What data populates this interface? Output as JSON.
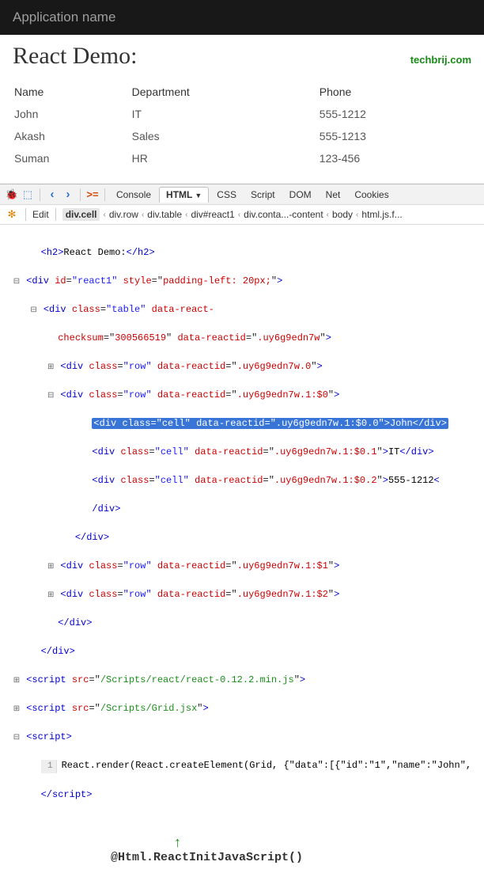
{
  "header": {
    "app_name": "Application name"
  },
  "page": {
    "title": "React Demo:",
    "brand": "techbrij.com"
  },
  "table": {
    "columns": [
      "Name",
      "Department",
      "Phone"
    ],
    "rows": [
      [
        "John",
        "IT",
        "555-1212"
      ],
      [
        "Akash",
        "Sales",
        "555-1213"
      ],
      [
        "Suman",
        "HR",
        "123-456"
      ]
    ]
  },
  "devtools": {
    "tabs": [
      "Console",
      "HTML",
      "CSS",
      "Script",
      "DOM",
      "Net",
      "Cookies"
    ],
    "active_tab": "HTML",
    "second_row": {
      "edit": "Edit"
    },
    "breadcrumbs": [
      "div.cell",
      "div.row",
      "div.table",
      "div#react1",
      "div.conta...-content",
      "body",
      "html.js.f..."
    ],
    "code": {
      "h2_text": "React Demo:",
      "react1_style": "padding-left: 20px;",
      "checksum": "300566519",
      "reactid_root": ".uy6g9edn7w",
      "reactid_row0": ".uy6g9edn7w.0",
      "reactid_row1": ".uy6g9edn7w.1:$0",
      "cell0_id": ".uy6g9edn7w.1:$0.0",
      "cell0_txt": "John",
      "cell1_id": ".uy6g9edn7w.1:$0.1",
      "cell1_txt": "IT",
      "cell2_id": ".uy6g9edn7w.1:$0.2",
      "cell2_txt": "555-1212",
      "row2_id": ".uy6g9edn7w.1:$1",
      "row3_id": ".uy6g9edn7w.1:$2",
      "script1_src": "/Scripts/react/react-0.12.2.min.js",
      "script2_src": "/Scripts/Grid.jsx",
      "inline_script": "React.render(React.createElement(Grid, {\"data\":[{\"id\":\"1\",\"name\":\"John\","
    }
  },
  "annotation": "@Html.ReactInitJavaScript()"
}
